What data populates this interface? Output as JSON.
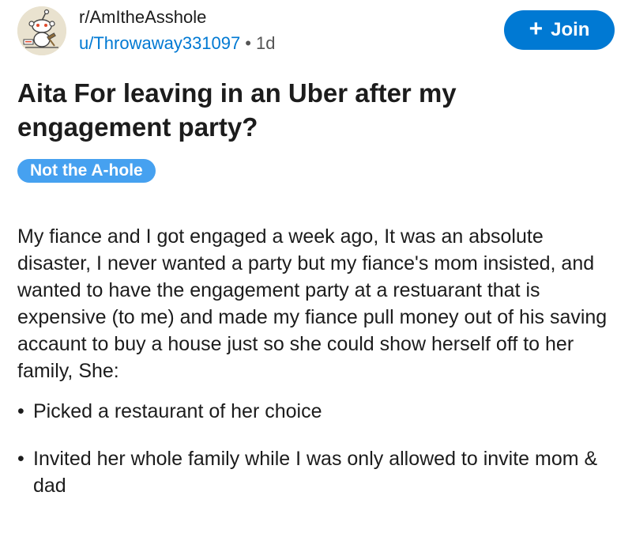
{
  "post": {
    "subreddit": "r/AmItheAsshole",
    "username": "u/Throwaway331097",
    "separator": "•",
    "age": "1d",
    "title": "Aita For leaving in an Uber after my engagement party?",
    "flair": "Not the A-hole",
    "body": "My fiance and I got engaged a week ago, It was an absolute disaster, I never wanted a party but my fiance's mom insisted, and wanted to have the engagement party at a restuarant that is expensive (to me) and made my fiance pull money out of his saving accaunt to buy a house just so she could show herself off to her family, She:",
    "bullets": [
      "Picked a restaurant of her choice",
      "Invited her whole family while I was only allowed to invite mom & dad"
    ],
    "bullet_symbol": "•"
  },
  "actions": {
    "join_label": "Join",
    "join_icon": "plus-icon"
  },
  "colors": {
    "accent": "#0079d3",
    "flair": "#46a1f0",
    "avatar_bg": "#e9e2cf"
  },
  "icons": {
    "avatar": "snoo-judge-avatar"
  }
}
